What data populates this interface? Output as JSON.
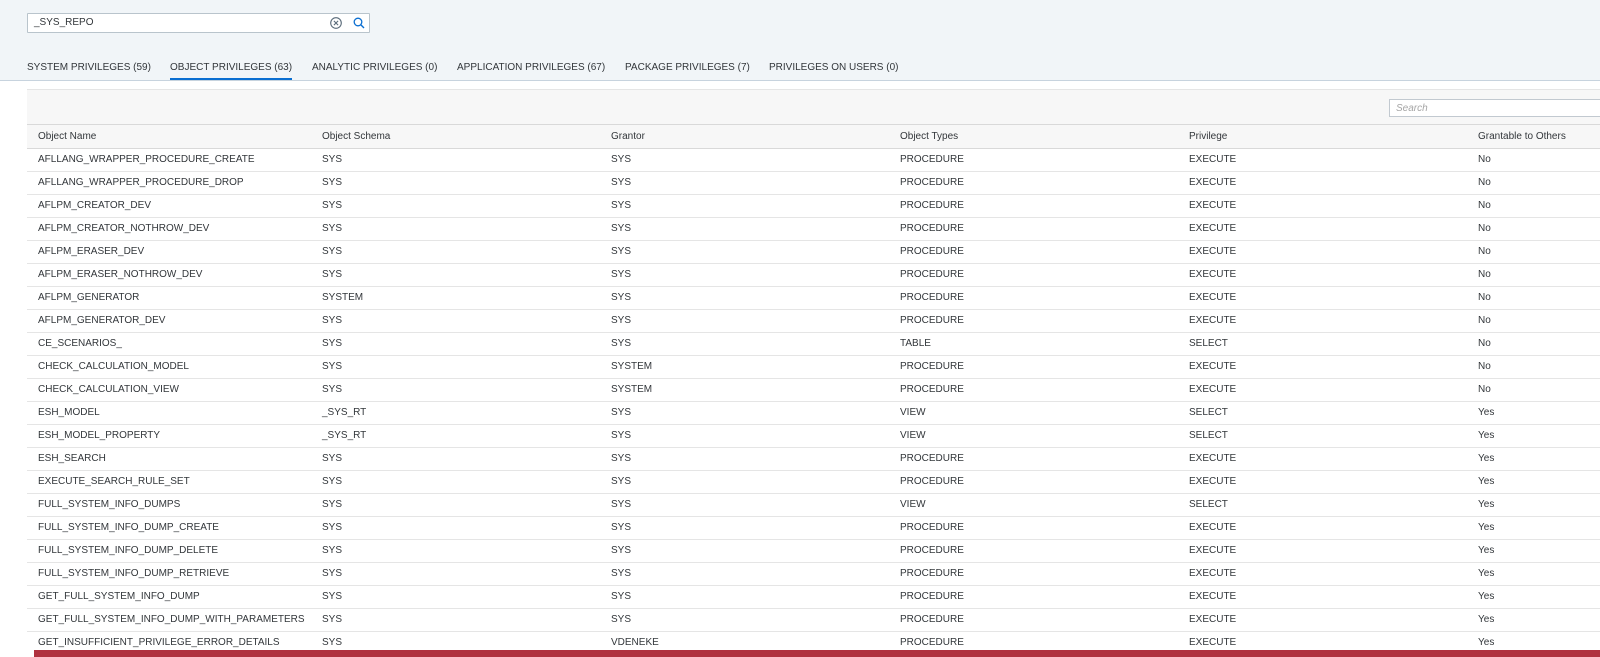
{
  "search": {
    "value": "_SYS_REPO"
  },
  "icons": {
    "clear": "clear-circle-icon",
    "search": "magnifier-icon"
  },
  "tabs": [
    {
      "label": "SYSTEM PRIVILEGES (59)",
      "active": false
    },
    {
      "label": "OBJECT PRIVILEGES (63)",
      "active": true
    },
    {
      "label": "ANALYTIC PRIVILEGES (0)",
      "active": false
    },
    {
      "label": "APPLICATION PRIVILEGES (67)",
      "active": false
    },
    {
      "label": "PACKAGE PRIVILEGES (7)",
      "active": false
    },
    {
      "label": "PRIVILEGES ON USERS (0)",
      "active": false
    }
  ],
  "table": {
    "search_placeholder": "Search",
    "columns": [
      "Object Name",
      "Object Schema",
      "Grantor",
      "Object Types",
      "Privilege",
      "Grantable to Others"
    ],
    "rows": [
      [
        "AFLLANG_WRAPPER_PROCEDURE_CREATE",
        "SYS",
        "SYS",
        "PROCEDURE",
        "EXECUTE",
        "No"
      ],
      [
        "AFLLANG_WRAPPER_PROCEDURE_DROP",
        "SYS",
        "SYS",
        "PROCEDURE",
        "EXECUTE",
        "No"
      ],
      [
        "AFLPM_CREATOR_DEV",
        "SYS",
        "SYS",
        "PROCEDURE",
        "EXECUTE",
        "No"
      ],
      [
        "AFLPM_CREATOR_NOTHROW_DEV",
        "SYS",
        "SYS",
        "PROCEDURE",
        "EXECUTE",
        "No"
      ],
      [
        "AFLPM_ERASER_DEV",
        "SYS",
        "SYS",
        "PROCEDURE",
        "EXECUTE",
        "No"
      ],
      [
        "AFLPM_ERASER_NOTHROW_DEV",
        "SYS",
        "SYS",
        "PROCEDURE",
        "EXECUTE",
        "No"
      ],
      [
        "AFLPM_GENERATOR",
        "SYSTEM",
        "SYS",
        "PROCEDURE",
        "EXECUTE",
        "No"
      ],
      [
        "AFLPM_GENERATOR_DEV",
        "SYS",
        "SYS",
        "PROCEDURE",
        "EXECUTE",
        "No"
      ],
      [
        "CE_SCENARIOS_",
        "SYS",
        "SYS",
        "TABLE",
        "SELECT",
        "No"
      ],
      [
        "CHECK_CALCULATION_MODEL",
        "SYS",
        "SYSTEM",
        "PROCEDURE",
        "EXECUTE",
        "No"
      ],
      [
        "CHECK_CALCULATION_VIEW",
        "SYS",
        "SYSTEM",
        "PROCEDURE",
        "EXECUTE",
        "No"
      ],
      [
        "ESH_MODEL",
        "_SYS_RT",
        "SYS",
        "VIEW",
        "SELECT",
        "Yes"
      ],
      [
        "ESH_MODEL_PROPERTY",
        "_SYS_RT",
        "SYS",
        "VIEW",
        "SELECT",
        "Yes"
      ],
      [
        "ESH_SEARCH",
        "SYS",
        "SYS",
        "PROCEDURE",
        "EXECUTE",
        "Yes"
      ],
      [
        "EXECUTE_SEARCH_RULE_SET",
        "SYS",
        "SYS",
        "PROCEDURE",
        "EXECUTE",
        "Yes"
      ],
      [
        "FULL_SYSTEM_INFO_DUMPS",
        "SYS",
        "SYS",
        "VIEW",
        "SELECT",
        "Yes"
      ],
      [
        "FULL_SYSTEM_INFO_DUMP_CREATE",
        "SYS",
        "SYS",
        "PROCEDURE",
        "EXECUTE",
        "Yes"
      ],
      [
        "FULL_SYSTEM_INFO_DUMP_DELETE",
        "SYS",
        "SYS",
        "PROCEDURE",
        "EXECUTE",
        "Yes"
      ],
      [
        "FULL_SYSTEM_INFO_DUMP_RETRIEVE",
        "SYS",
        "SYS",
        "PROCEDURE",
        "EXECUTE",
        "Yes"
      ],
      [
        "GET_FULL_SYSTEM_INFO_DUMP",
        "SYS",
        "SYS",
        "PROCEDURE",
        "EXECUTE",
        "Yes"
      ],
      [
        "GET_FULL_SYSTEM_INFO_DUMP_WITH_PARAMETERS",
        "SYS",
        "SYS",
        "PROCEDURE",
        "EXECUTE",
        "Yes"
      ],
      [
        "GET_INSUFFICIENT_PRIVILEGE_ERROR_DETAILS",
        "SYS",
        "VDENEKE",
        "PROCEDURE",
        "EXECUTE",
        "Yes"
      ]
    ]
  },
  "colors": {
    "accent": "#0a6ed1",
    "header_bg": "#f1f5f8",
    "selection_strip": "#b0313f"
  }
}
